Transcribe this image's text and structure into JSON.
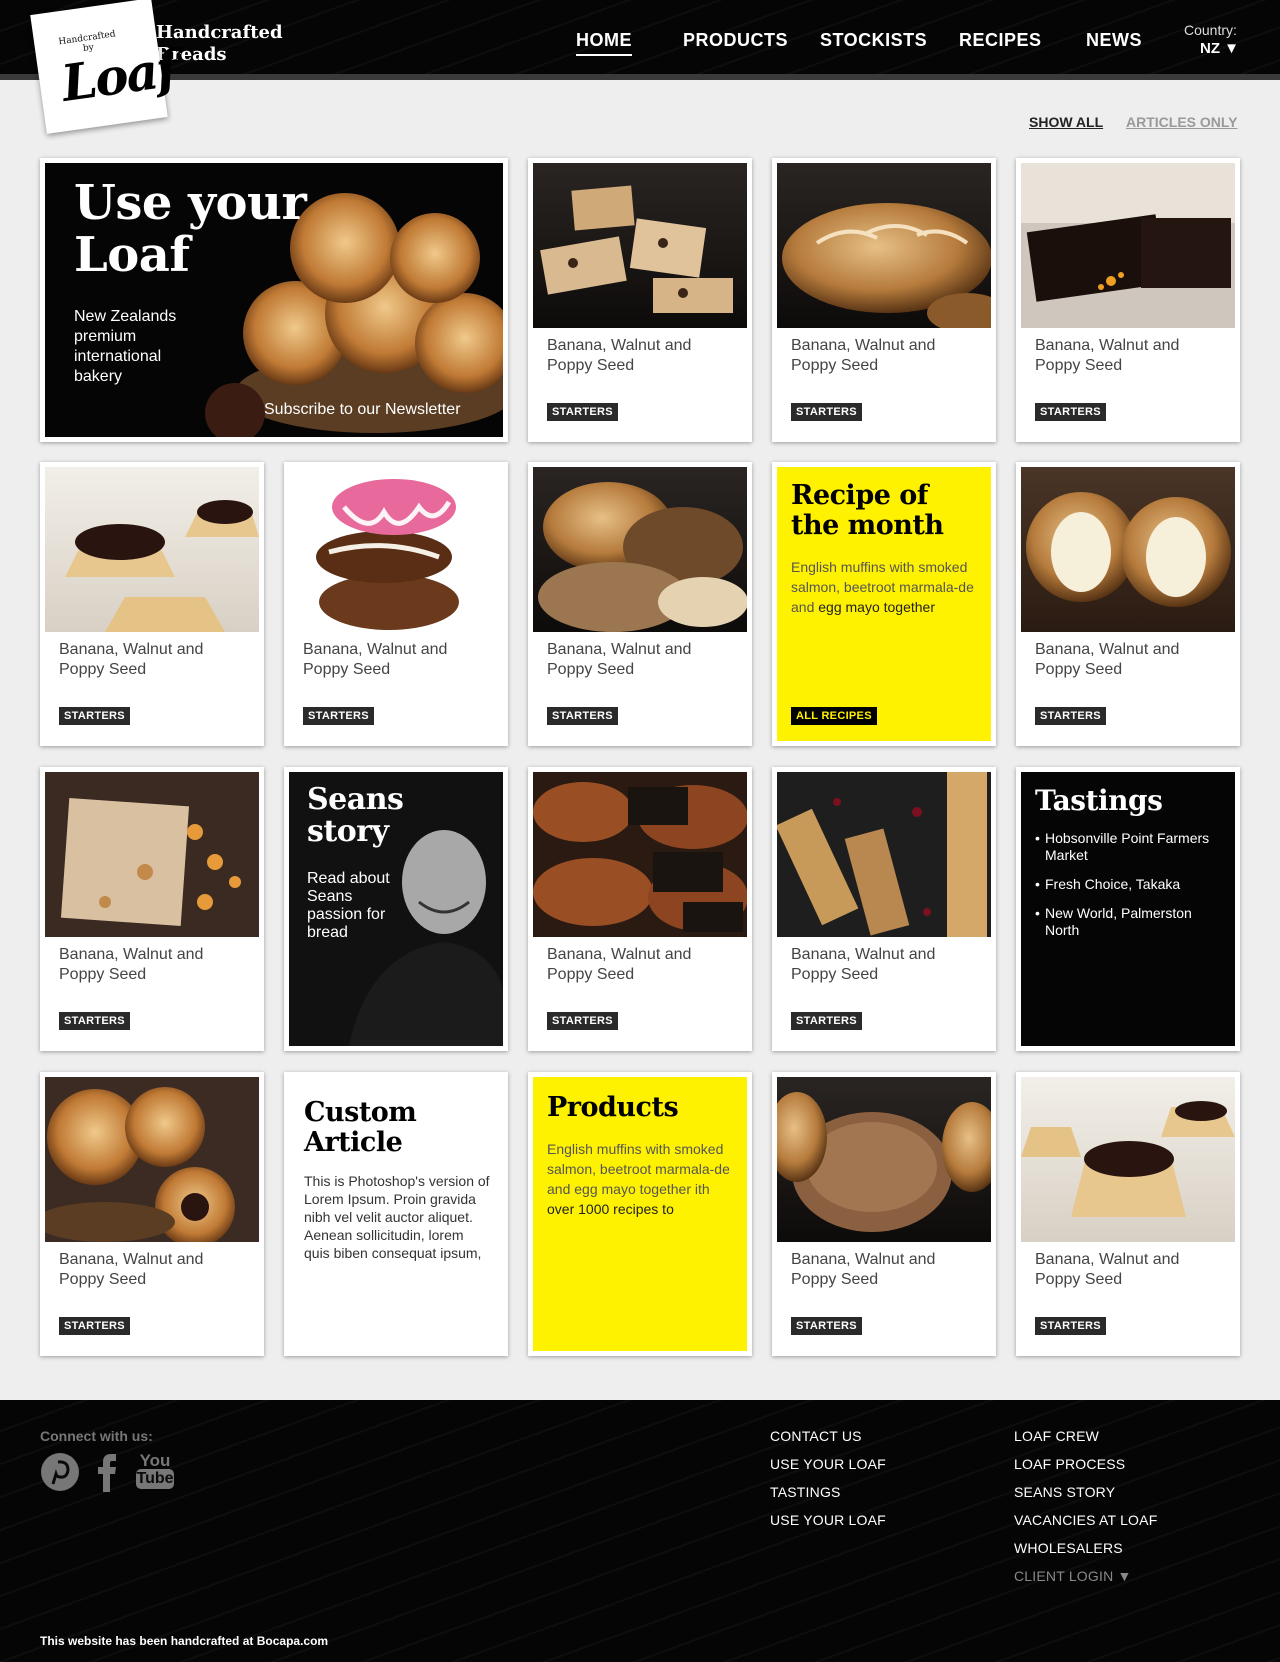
{
  "brand": {
    "logo_small": "Handcrafted by",
    "logo_big": "Loaf",
    "tagline_line1": "Handcrafted",
    "tagline_line2": "Breads"
  },
  "nav": {
    "home": "HOME",
    "products": "PRODUCTS",
    "stockists": "STOCKISTS",
    "recipes": "RECIPES",
    "news": "NEWS",
    "country_label": "Country:",
    "country_value": "NZ ▼"
  },
  "filter": {
    "show_all": "SHOW ALL",
    "articles_only": "ARTICLES ONLY"
  },
  "hero": {
    "title_line1": "Use your",
    "title_line2": "Loaf",
    "subtitle": "New Zealands premium international bakery",
    "newsletter": "Subscribe to our Newsletter"
  },
  "card_title": "Banana, Walnut and Poppy Seed",
  "card_tag": "STARTERS",
  "recipe_month": {
    "title_line1": "Recipe of",
    "title_line2": "the month",
    "body": "English muffins with smoked salmon, beetroot marmala-de and ",
    "body_bold": "egg mayo together",
    "button": "ALL RECIPES"
  },
  "seans": {
    "title_line1": "Seans",
    "title_line2": "story",
    "body": "Read about Seans passion for bread"
  },
  "tastings": {
    "title": "Tastings",
    "items": [
      "Hobsonville Point Farmers Market",
      "Fresh Choice, Takaka",
      "New World, Palmerston North"
    ]
  },
  "custom_article": {
    "title_line1": "Custom",
    "title_line2": "Article",
    "body": "This is Photoshop's version of Lorem Ipsum. Proin gravida nibh vel velit auctor aliquet. Aenean sollicitudin, lorem quis biben consequat ipsum,"
  },
  "products_card": {
    "title": "Products",
    "body": "English muffins with smoked salmon, beetroot marmala-de and egg mayo together ith ",
    "body_bold": "over 1000 recipes to"
  },
  "footer": {
    "connect": "Connect with us:",
    "social": [
      "pinterest-icon",
      "facebook-icon",
      "youtube-icon"
    ],
    "youtube_top": "You",
    "youtube_bottom": "Tube",
    "col1": [
      "CONTACT US",
      "USE YOUR LOAF",
      "TASTINGS",
      "USE YOUR LOAF"
    ],
    "col2": [
      "LOAF CREW",
      "LOAF PROCESS",
      "SEANS STORY",
      "VACANCIES AT LOAF",
      "WHOLESALERS"
    ],
    "client_login": "CLIENT LOGIN ▼",
    "credit": "This website has been handcrafted at Bocapa.com"
  },
  "colors": {
    "accent_yellow": "#fff200",
    "header_black": "#050505",
    "tag_dark": "#2a2a2a"
  }
}
